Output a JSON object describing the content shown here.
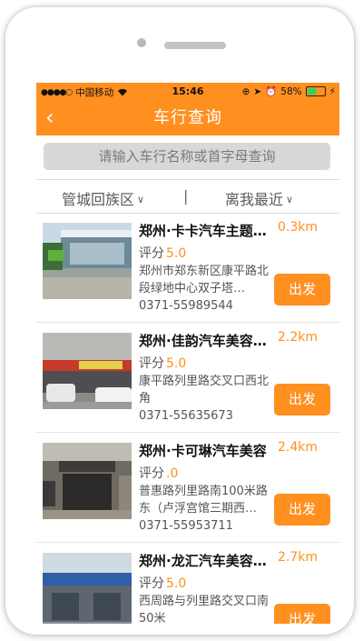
{
  "status_bar": {
    "carrier": "中国移动",
    "time": "15:46",
    "battery": "58%",
    "battery_level": 0.58
  },
  "nav": {
    "title": "车行查询",
    "back_icon": "chevron-left-icon"
  },
  "search": {
    "placeholder": "请输入车行名称或首字母查询"
  },
  "filters": {
    "district": "管城回族区",
    "separator": "|",
    "sort": "离我最近"
  },
  "colors": {
    "accent": "#ff8f1f",
    "search_bg": "#d8d8d8"
  },
  "shops": [
    {
      "name": "郑州·卡卡汽车主题…",
      "distance": "0.3km",
      "rating_label": "评分",
      "rating": "5.0",
      "address": "郑州市郑东新区康平路北段绿地中心双子塔…",
      "phone": "0371-55989544",
      "action": "出发"
    },
    {
      "name": "郑州·佳韵汽车美容…",
      "distance": "2.2km",
      "rating_label": "评分",
      "rating": "5.0",
      "address": "康平路列里路交叉口西北角",
      "phone": "0371-55635673",
      "action": "出发"
    },
    {
      "name": "郑州·卡可琳汽车美容",
      "distance": "2.4km",
      "rating_label": "评分",
      "rating": ".0",
      "address": "普惠路列里路南100米路东（卢浮宫馆三期西…",
      "phone": "0371-55953711",
      "action": "出发"
    },
    {
      "name": "郑州·龙汇汽车美容…",
      "distance": "2.7km",
      "rating_label": "评分",
      "rating": "5.0",
      "address": "西周路与列里路交叉口南50米",
      "phone": "",
      "action": "出发"
    }
  ]
}
